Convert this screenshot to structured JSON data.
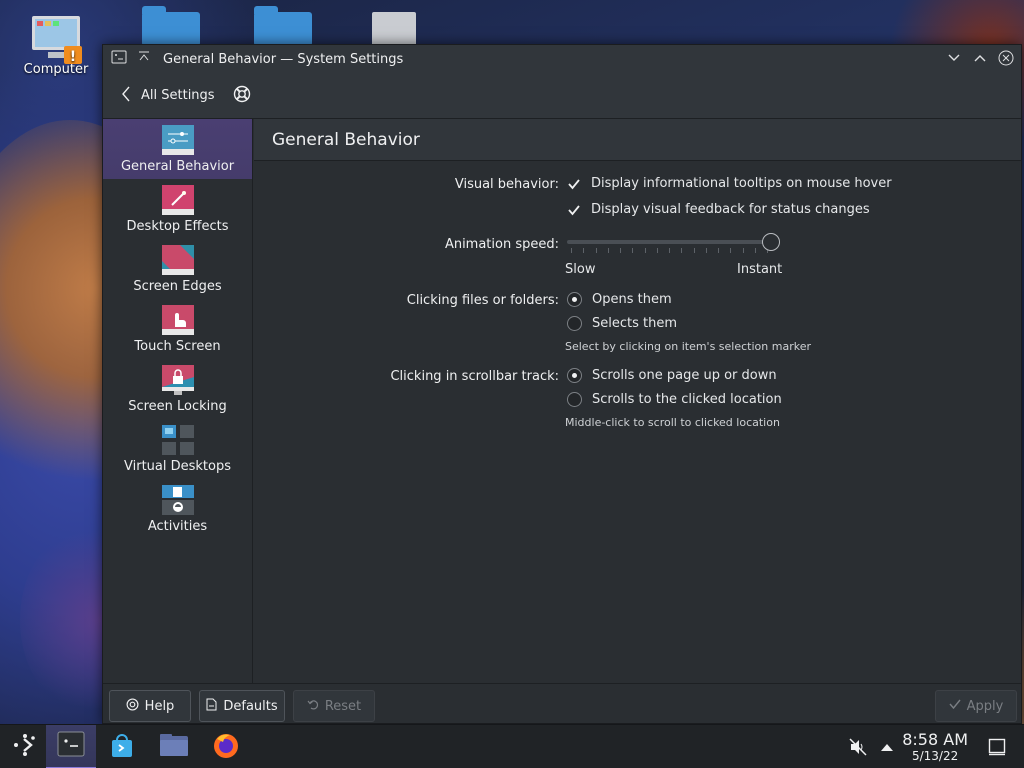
{
  "desktop": {
    "icons": [
      {
        "label": "Computer"
      }
    ]
  },
  "window": {
    "title": "General Behavior — System Settings",
    "toolbar": {
      "back_label": "All Settings"
    },
    "sidebar": {
      "items": [
        {
          "label": "General Behavior",
          "active": true
        },
        {
          "label": "Desktop Effects"
        },
        {
          "label": "Screen Edges"
        },
        {
          "label": "Touch Screen"
        },
        {
          "label": "Screen Locking"
        },
        {
          "label": "Virtual Desktops"
        },
        {
          "label": "Activities"
        }
      ]
    },
    "page_title": "General Behavior",
    "settings": {
      "visual": {
        "label": "Visual behavior:",
        "options": [
          {
            "text": "Display informational tooltips on mouse hover",
            "checked": true
          },
          {
            "text": "Display visual feedback for status changes",
            "checked": true
          }
        ]
      },
      "animation": {
        "label": "Animation speed:",
        "min_label": "Slow",
        "max_label": "Instant",
        "value": 1.0
      },
      "clicking": {
        "label": "Clicking files or folders:",
        "options": [
          {
            "text": "Opens them",
            "selected": true
          },
          {
            "text": "Selects them",
            "selected": false
          }
        ],
        "hint": "Select by clicking on item's selection marker"
      },
      "scrollbar": {
        "label": "Clicking in scrollbar track:",
        "options": [
          {
            "text": "Scrolls one page up or down",
            "selected": true
          },
          {
            "text": "Scrolls to the clicked location",
            "selected": false
          }
        ],
        "hint": "Middle-click to scroll to clicked location"
      }
    },
    "footer": {
      "help": "Help",
      "defaults": "Defaults",
      "reset": "Reset",
      "apply": "Apply"
    }
  },
  "taskbar": {
    "time": "8:58 AM",
    "date": "5/13/22"
  },
  "colors": {
    "accent": "#3daee9",
    "active_item": "#453c6b",
    "window_bg": "#2a2e32",
    "header_bg": "#31363b"
  }
}
